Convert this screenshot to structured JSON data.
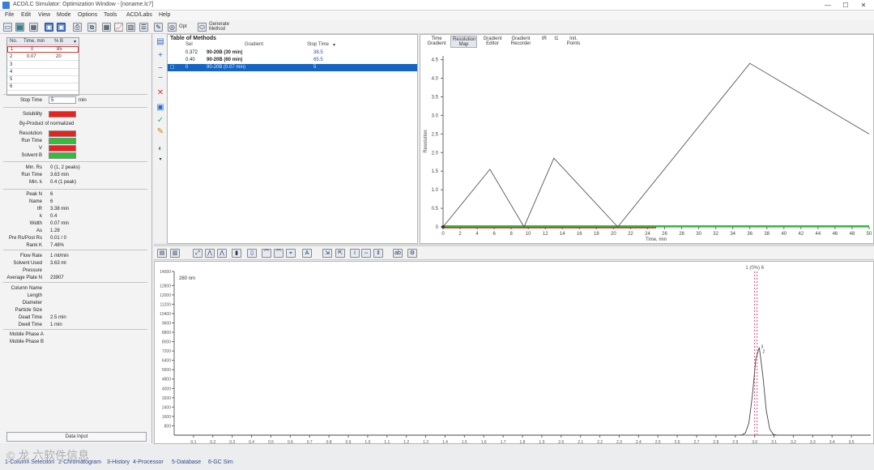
{
  "window": {
    "title": "ACD/LC Simulator: Optimization Window - [noname.lc7]"
  },
  "menu": [
    "File",
    "Edit",
    "View",
    "Mode",
    "Options",
    "Tools",
    "ACD/Labs",
    "Help"
  ],
  "toolbar": {
    "opt_label": "Opt",
    "method_label": "Generate\nMethod"
  },
  "runs_table": {
    "headers": [
      "No.",
      "Time, min",
      "% B"
    ],
    "rows": [
      {
        "no": "1",
        "time": "0",
        "b": "85"
      },
      {
        "no": "2",
        "time": "0.07",
        "b": "20"
      },
      {
        "no": "3",
        "time": "",
        "b": ""
      },
      {
        "no": "4",
        "time": "",
        "b": ""
      },
      {
        "no": "5",
        "time": "",
        "b": ""
      },
      {
        "no": "6",
        "time": "",
        "b": ""
      }
    ]
  },
  "stop_time": {
    "label": "Stop Time",
    "value": "5",
    "unit": "min"
  },
  "criteria": {
    "solubility_label": "Solubility",
    "byproduct_label": "By-Product of normalized",
    "resolution_label": "Resolution",
    "runtime_label": "Run Time",
    "v_label": "V",
    "solvent_label": "Solvent B",
    "colors": [
      "#e8221e",
      "#2fbf3a",
      "#e8221e",
      "#2fbf3a"
    ]
  },
  "summary": [
    {
      "label": "Min. Rs",
      "value": "0 (1, 2 peaks)"
    },
    {
      "label": "Run Time",
      "value": "3.63 min"
    },
    {
      "label": "Min. k",
      "value": "0.4 (1 peak)"
    }
  ],
  "peak": [
    {
      "label": "Peak N",
      "value": "6"
    },
    {
      "label": "Name",
      "value": "6"
    },
    {
      "label": "tR",
      "value": "3.38 min"
    },
    {
      "label": "k",
      "value": "0.4"
    },
    {
      "label": "Width",
      "value": "0.07 min"
    },
    {
      "label": "As",
      "value": "1.28"
    },
    {
      "label": "Pre Rs/Post Rs",
      "value": "0.01 / 0"
    },
    {
      "label": "Rank K",
      "value": "7.48%"
    }
  ],
  "flow": [
    {
      "label": "Flow Rate",
      "value": "1 ml/min"
    },
    {
      "label": "Solvent Used",
      "value": "3.63 ml"
    },
    {
      "label": "Pressure",
      "value": ""
    },
    {
      "label": "Average Plate N",
      "value": "23907"
    }
  ],
  "column": [
    {
      "label": "Column Name",
      "value": ""
    },
    {
      "label": "Length",
      "value": ""
    },
    {
      "label": "Diameter",
      "value": ""
    },
    {
      "label": "Particle Size",
      "value": ""
    },
    {
      "label": "Dead Time",
      "value": "2.5 min"
    },
    {
      "label": "Dwell Time",
      "value": "1 min"
    }
  ],
  "mobile": [
    {
      "label": "Mobile Phase A",
      "value": ""
    },
    {
      "label": "Mobile Phase B",
      "value": ""
    }
  ],
  "data_input_label": "Data Input",
  "methods": {
    "title": "Table of Methods",
    "headers": [
      "Sel",
      "Gradient",
      "Stop Time"
    ],
    "rows": [
      {
        "sel": "0.372",
        "gradient": "90-20B (30 min)",
        "stop": "38.5",
        "selected": false
      },
      {
        "sel": "0.40",
        "gradient": "90-20B (60 min)",
        "stop": "65.5",
        "selected": false
      },
      {
        "sel": "0",
        "gradient": "90-20B (0.07 min)",
        "stop": "5",
        "selected": true
      }
    ]
  },
  "plot_tabs": [
    {
      "label": "Time\nGradient",
      "active": false
    },
    {
      "label": "Resolution\nMap",
      "active": true
    },
    {
      "label": "Gradient\nEditor",
      "active": false
    },
    {
      "label": "Gradient\nRecorder",
      "active": false
    },
    {
      "label": "tR",
      "active": false
    },
    {
      "label": "t1",
      "active": false
    },
    {
      "label": "Init.\nPoints",
      "active": false
    }
  ],
  "chart_data": [
    {
      "type": "line",
      "xlabel": "Time, min",
      "ylabel": "Resolution",
      "xlim": [
        0,
        50
      ],
      "ylim": [
        0,
        4.6
      ],
      "xticks": [
        0,
        2,
        4,
        6,
        8,
        10,
        12,
        14,
        16,
        18,
        20,
        22,
        24,
        26,
        28,
        30,
        32,
        34,
        36,
        38,
        40,
        42,
        44,
        46,
        48,
        50
      ],
      "yticks": [
        0,
        0.5,
        1.0,
        1.5,
        2.0,
        2.5,
        3.0,
        3.5,
        4.0,
        4.5
      ],
      "ytick_labels": [
        "0",
        "0.5",
        "1.0",
        "1.5",
        "2.0",
        "2.5",
        "3.0",
        "3.5",
        "4.0",
        "4.5"
      ],
      "series": [
        {
          "x": [
            0,
            5.5,
            9.5,
            13,
            20.5,
            36,
            50
          ],
          "y": [
            0,
            1.55,
            0,
            1.85,
            0,
            4.4,
            2.5
          ],
          "color": "#555555"
        }
      ],
      "baseline_colors": [
        "#2fbf3a",
        "#e8221e"
      ]
    },
    {
      "type": "line",
      "xlabel": "",
      "ylabel": "",
      "xlim": [
        0,
        3.6
      ],
      "ylim": [
        0,
        14000
      ],
      "trace_label": "280 nm",
      "peak_label": "1 (0%) 6",
      "peak_annotations": [
        "3",
        "2"
      ],
      "xticks": [
        0.1,
        0.2,
        0.3,
        0.4,
        0.5,
        0.6,
        0.7,
        0.8,
        0.9,
        1.0,
        1.1,
        1.2,
        1.3,
        1.4,
        1.5,
        1.6,
        1.7,
        1.8,
        1.9,
        2.0,
        2.1,
        2.2,
        2.3,
        2.4,
        2.5,
        2.6,
        2.7,
        2.8,
        2.9,
        3.0,
        3.1,
        3.2,
        3.3,
        3.4,
        3.5
      ],
      "yticks": [
        800,
        1600,
        2400,
        3200,
        4000,
        4800,
        5600,
        6400,
        7200,
        8000,
        8800,
        9600,
        10400,
        11200,
        12000,
        12800,
        14000
      ],
      "ytick_labels": [
        "800",
        "1600",
        "2400",
        "3200",
        "4000",
        "4800",
        "5600",
        "6400",
        "7200",
        "8000",
        "8800",
        "9600",
        "10400",
        "11200",
        "12000",
        "12800",
        "14000"
      ],
      "peak": {
        "center": 3.02,
        "height": 7600,
        "width": 0.025
      },
      "marker_x": 3.0,
      "marker_color": "#e0457a"
    }
  ],
  "bottom_tabs": [
    "1-Column Selection",
    "2-Chromatogram",
    "3-History",
    "4-Processor",
    "5-Database",
    "6-GC Sim"
  ],
  "watermark": "© 龙 六软件信息"
}
